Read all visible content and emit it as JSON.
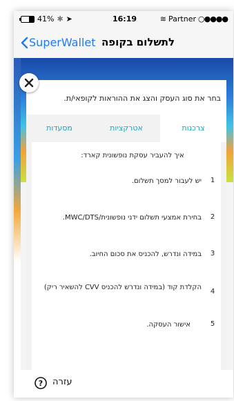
{
  "status_bar": {
    "battery_percent": "41%",
    "battery_level": 0.41,
    "time": "16:19",
    "carrier": "Partner"
  },
  "nav": {
    "back_label": "SuperWallet",
    "title": "לתשלום בקופה"
  },
  "card": {
    "instruction": "בחר את סוג העסק והצג את ההוראות לקופאי/ת.",
    "tabs": [
      {
        "label": "צרכנות",
        "active": true
      },
      {
        "label": "אטרקציות",
        "active": false
      },
      {
        "label": "מסעדות",
        "active": false
      }
    ],
    "heading": "איך להעביר עסקת נופשונית קארד:",
    "steps": [
      {
        "number": "1",
        "text": "יש לעבור למסך תשלום."
      },
      {
        "number": "2",
        "text": "בחירת אמצעי תשלום ידני נופשונית/MWC/DTS."
      },
      {
        "number": "3",
        "text": "במידה ונדרש, להכניס את סכום החיוב."
      },
      {
        "number": "4",
        "text": "הקלדת קוד (במידה ונדרש להכניס CVV להשאיר ריק)"
      },
      {
        "number": "5",
        "text": "אישור העסקה."
      }
    ]
  },
  "footer": {
    "help_label": "עזרה"
  },
  "colors": {
    "accent_blue": "#1f7af3",
    "tab_teal": "#1aa6b7"
  }
}
